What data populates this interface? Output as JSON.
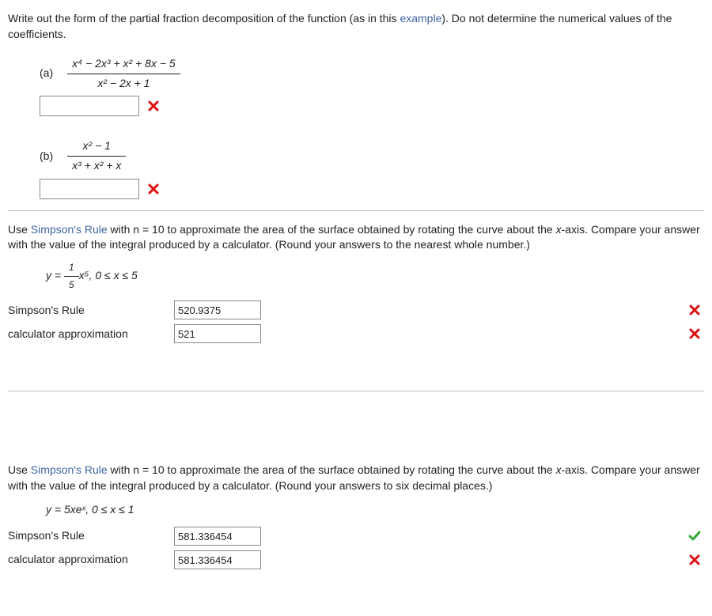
{
  "q1": {
    "instruction_pre": "Write out the form of the partial fraction decomposition of the function (as in this ",
    "example_link": "example",
    "instruction_post": "). Do not determine the numerical values of the coefficients.",
    "a": {
      "label": "(a)",
      "num": "x⁴ − 2x³ + x² + 8x − 5",
      "den": "x² − 2x + 1",
      "result": "wrong"
    },
    "b": {
      "label": "(b)",
      "num": "x² − 1",
      "den": "x³ + x² + x",
      "result": "wrong"
    }
  },
  "q2": {
    "text_pre": "Use ",
    "link": "Simpson's Rule",
    "text_mid": " with  n = 10  to approximate the area of the surface obtained by rotating the curve about the ",
    "axis": "x",
    "text_post": "-axis. Compare your answer with the value of the integral produced by a calculator. (Round your answers to the nearest whole number.)",
    "eq_left": "y = ",
    "eq_frac_top": "1",
    "eq_frac_bot": "5",
    "eq_right": "x⁵,   0 ≤ x ≤ 5",
    "rows": {
      "simp": {
        "label": "Simpson's Rule",
        "value": "520.9375",
        "result": "wrong"
      },
      "calc": {
        "label": "calculator approximation",
        "value": "521",
        "result": "wrong"
      }
    }
  },
  "q3": {
    "text_pre": "Use ",
    "link": "Simpson's Rule",
    "text_mid": " with  n = 10  to approximate the area of the surface obtained by rotating the curve about the ",
    "axis": "x",
    "text_post": "-axis. Compare your answer with the value of the integral produced by a calculator. (Round your answers to six decimal places.)",
    "eq": "y = 5xeˣ,   0 ≤ x ≤ 1",
    "rows": {
      "simp": {
        "label": "Simpson's Rule",
        "value": "581.336454",
        "result": "correct"
      },
      "calc": {
        "label": "calculator approximation",
        "value": "581.336454",
        "result": "wrong"
      }
    }
  }
}
